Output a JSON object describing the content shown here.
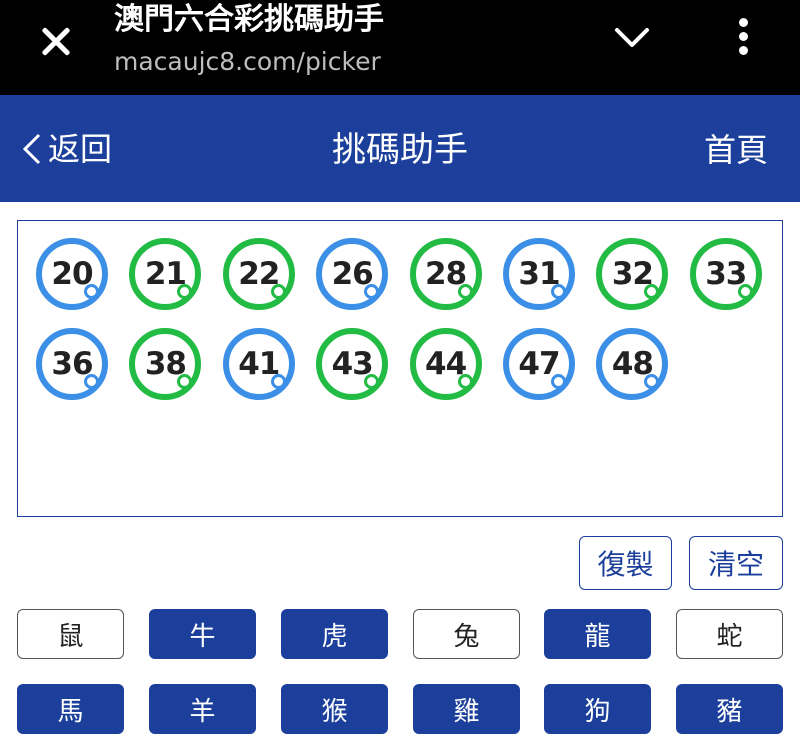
{
  "browser": {
    "title": "澳門六合彩挑碼助手",
    "url": "macaujc8.com/picker"
  },
  "header": {
    "back_label": "返回",
    "title": "挑碼助手",
    "home_label": "首頁",
    "bg_color": "#1b3f9a"
  },
  "picks": [
    {
      "number": "20",
      "color": "blue"
    },
    {
      "number": "21",
      "color": "green"
    },
    {
      "number": "22",
      "color": "green"
    },
    {
      "number": "26",
      "color": "blue"
    },
    {
      "number": "28",
      "color": "green"
    },
    {
      "number": "31",
      "color": "blue"
    },
    {
      "number": "32",
      "color": "green"
    },
    {
      "number": "33",
      "color": "green"
    },
    {
      "number": "36",
      "color": "blue"
    },
    {
      "number": "38",
      "color": "green"
    },
    {
      "number": "41",
      "color": "blue"
    },
    {
      "number": "43",
      "color": "green"
    },
    {
      "number": "44",
      "color": "green"
    },
    {
      "number": "47",
      "color": "blue"
    },
    {
      "number": "48",
      "color": "blue"
    }
  ],
  "actions": {
    "copy_label": "復製",
    "clear_label": "清空"
  },
  "zodiac": [
    {
      "label": "鼠",
      "selected": false
    },
    {
      "label": "牛",
      "selected": true
    },
    {
      "label": "虎",
      "selected": true
    },
    {
      "label": "兔",
      "selected": false
    },
    {
      "label": "龍",
      "selected": true
    },
    {
      "label": "蛇",
      "selected": false
    },
    {
      "label": "馬",
      "selected": true
    },
    {
      "label": "羊",
      "selected": true
    },
    {
      "label": "猴",
      "selected": true
    },
    {
      "label": "雞",
      "selected": true
    },
    {
      "label": "狗",
      "selected": true
    },
    {
      "label": "豬",
      "selected": true
    }
  ],
  "colors": {
    "blue_ball": "#3b8fe6",
    "green_ball": "#22bb44",
    "accent": "#1b3f9a"
  }
}
